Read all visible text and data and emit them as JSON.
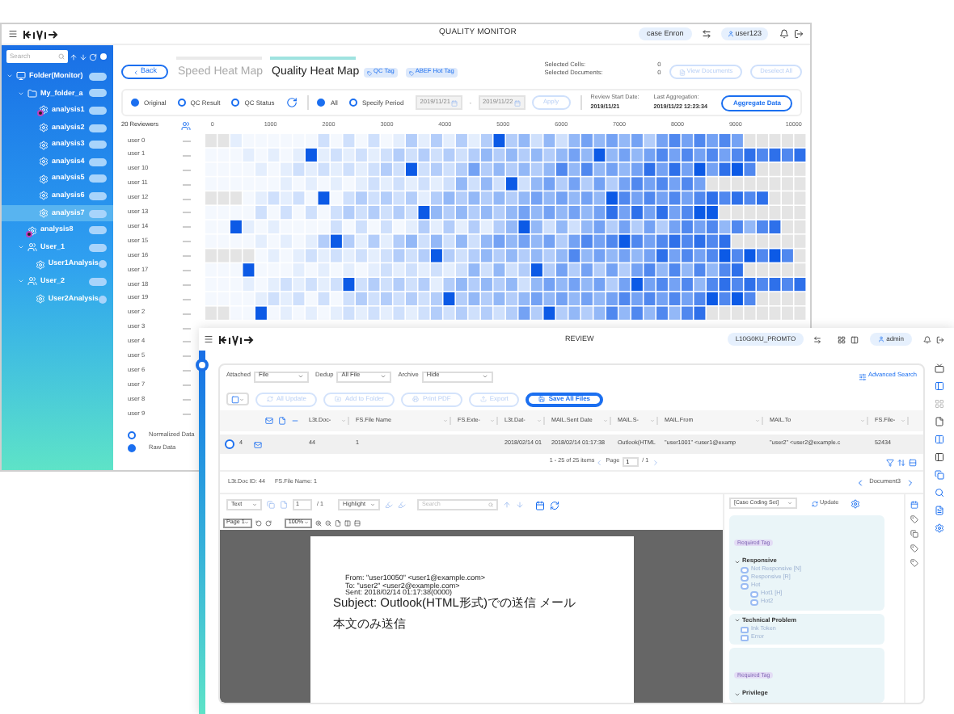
{
  "monitor": {
    "title": "QUALITY MONITOR",
    "case": "case Enron",
    "user": "user123",
    "search": {
      "placeholder": "Search"
    },
    "tree": [
      {
        "label": "Folder(Monitor)",
        "expanded": true,
        "selected": false,
        "marked": false,
        "children": [
          {
            "label": "My_folder_a",
            "expanded": true,
            "selected": false,
            "marked": false,
            "children": [
              {
                "label": "analysis1",
                "selected": false,
                "marked": true
              },
              {
                "label": "analysis2",
                "selected": false,
                "marked": false
              },
              {
                "label": "analysis3",
                "selected": false,
                "marked": false
              },
              {
                "label": "analysis4",
                "selected": false,
                "marked": false
              },
              {
                "label": "analysis5",
                "selected": false,
                "marked": false
              },
              {
                "label": "analysis6",
                "selected": false,
                "marked": false
              },
              {
                "label": "analysis7",
                "selected": true,
                "marked": false
              }
            ]
          },
          {
            "label": "analysis8",
            "selected": false,
            "marked": true
          },
          {
            "label": "User_1",
            "expanded": true,
            "selected": false,
            "marked": false,
            "children": [
              {
                "label": "User1Analysis",
                "selected": false,
                "marked": false
              }
            ]
          },
          {
            "label": "User_2",
            "expanded": true,
            "selected": false,
            "marked": false,
            "children": [
              {
                "label": "User2Analysis",
                "selected": false,
                "marked": false
              }
            ]
          }
        ]
      }
    ],
    "back": "Back",
    "tabs": [
      {
        "label": "Speed Heat Map",
        "selected": false
      },
      {
        "label": "Quality Heat Map",
        "selected": true
      }
    ],
    "tags": [
      "QC Tag",
      "ABEF Hot Tag"
    ],
    "selection": [
      {
        "label": "Selected Cells:",
        "value": "0"
      },
      {
        "label": "Selected Documents:",
        "value": "0"
      }
    ],
    "actions": [
      {
        "label": "View Documents",
        "disabled": true
      },
      {
        "label": "Deselect All",
        "disabled": true
      }
    ],
    "modes": [
      {
        "label": "Original",
        "selected": true
      },
      {
        "label": "QC Result",
        "selected": false
      },
      {
        "label": "QC Status",
        "selected": false
      }
    ],
    "periods": [
      {
        "label": "All",
        "selected": true
      },
      {
        "label": "Specify Period",
        "selected": false
      }
    ],
    "date_from": "2019/11/21",
    "range_separator": "-",
    "date_to": "2019/11/22",
    "apply": "Apply",
    "info": [
      {
        "label": "Review Start Date:",
        "value": "2019/11/21"
      },
      {
        "label": "Last Aggregation:",
        "value": "2019/11/22 12:23:34"
      }
    ],
    "aggregate": "Aggregate Data",
    "reviewers": "20 Reviewers",
    "ticks": [
      "0",
      "1000",
      "2000",
      "3000",
      "4000",
      "5000",
      "6000",
      "7000",
      "8000",
      "9000",
      "10000"
    ],
    "rows": [
      "user 0",
      "user 1",
      "user 10",
      "user 11",
      "user 12",
      "user 13",
      "user 14",
      "user 15",
      "user 16",
      "user 17",
      "user 18",
      "user 19",
      "user 2",
      "user 3",
      "user 4",
      "user 5",
      "user 6",
      "user 7",
      "user 8",
      "user 9"
    ],
    "legend": [
      {
        "label": "Normalized Data",
        "selected": false
      },
      {
        "label": "Raw Data",
        "selected": true
      }
    ]
  },
  "review": {
    "title": "REVIEW",
    "case": "L10G0KU_PROMTO",
    "user": "admin",
    "filters": [
      {
        "label": "Attached",
        "value": "File"
      },
      {
        "label": "Dedup",
        "value": "All File"
      },
      {
        "label": "Archive",
        "value": "Hide"
      }
    ],
    "advanced": "Advanced Search",
    "buttons": [
      {
        "label": "All Update",
        "disabled": true
      },
      {
        "label": "Add to Folder",
        "disabled": true
      },
      {
        "label": "Print PDF",
        "disabled": true
      },
      {
        "label": "Export",
        "disabled": true
      },
      {
        "label": "Save All Files",
        "disabled": false
      }
    ],
    "columns": [
      "L3t.Doc-",
      "FS.File Name",
      "FS.Exte-",
      "L3t.Dat-",
      "MAIL.Sent Date",
      "MAIL.S-",
      "MAIL.From",
      "MAIL.To",
      "FS.File-"
    ],
    "rows": [
      {
        "checked": false,
        "number": "4",
        "cells": [
          "44",
          "1",
          "",
          "2018/02/14 01",
          "2018/02/14 01:17:38",
          "Outlook(HTML",
          "\"user1001\" <user1@examp",
          "\"user2\" <user2@example.c",
          "52434"
        ]
      }
    ],
    "pager": {
      "summary": "1 - 25 of 25 items",
      "page_label": "Page",
      "page": "1",
      "total": "/ 1"
    },
    "doc_info": [
      {
        "label": "L3t.Doc ID:",
        "value": "44"
      },
      {
        "label": "FS.File Name:",
        "value": "1"
      }
    ],
    "doc_nav": "Document3",
    "viewer": {
      "mode": "Text",
      "page": "1",
      "pages": "/ 1",
      "highlight": "Highlight",
      "search": {
        "placeholder": "Search"
      },
      "page_select": "Page 1",
      "zoom": "100%",
      "lines": [
        "From: \"user10050\" <user1@example.com>",
        "To: \"user2\" <user2@example.com>",
        "Sent: 2018/02/14 01:17:38(0000)",
        "Subject: Outlook(HTML形式)での送信 メール"
      ],
      "body": "本文のみ送信"
    },
    "coding": {
      "set": "[Case Coding Set]",
      "update": "Update",
      "groups": [
        {
          "badge": "Required Tag",
          "label": "Responsive",
          "expanded": true,
          "items": [
            {
              "label": "Not Responsive [N]",
              "kind": "radio",
              "checked": false
            },
            {
              "label": "Responsive [R]",
              "kind": "radio",
              "checked": false
            },
            {
              "label": "Hot",
              "kind": "radio",
              "checked": false,
              "children": [
                {
                  "label": "Hot1 [H]",
                  "kind": "radio",
                  "checked": false
                },
                {
                  "label": "Hot2",
                  "kind": "radio",
                  "checked": false
                }
              ]
            }
          ]
        },
        {
          "label": "Technical Problem",
          "expanded": true,
          "items": [
            {
              "label": "Ink Token",
              "kind": "checkbox",
              "checked": false
            },
            {
              "label": "Error",
              "kind": "checkbox",
              "checked": false
            }
          ]
        },
        {
          "badge": "Required Tag",
          "label": "Privilege",
          "expanded": true
        }
      ]
    }
  }
}
